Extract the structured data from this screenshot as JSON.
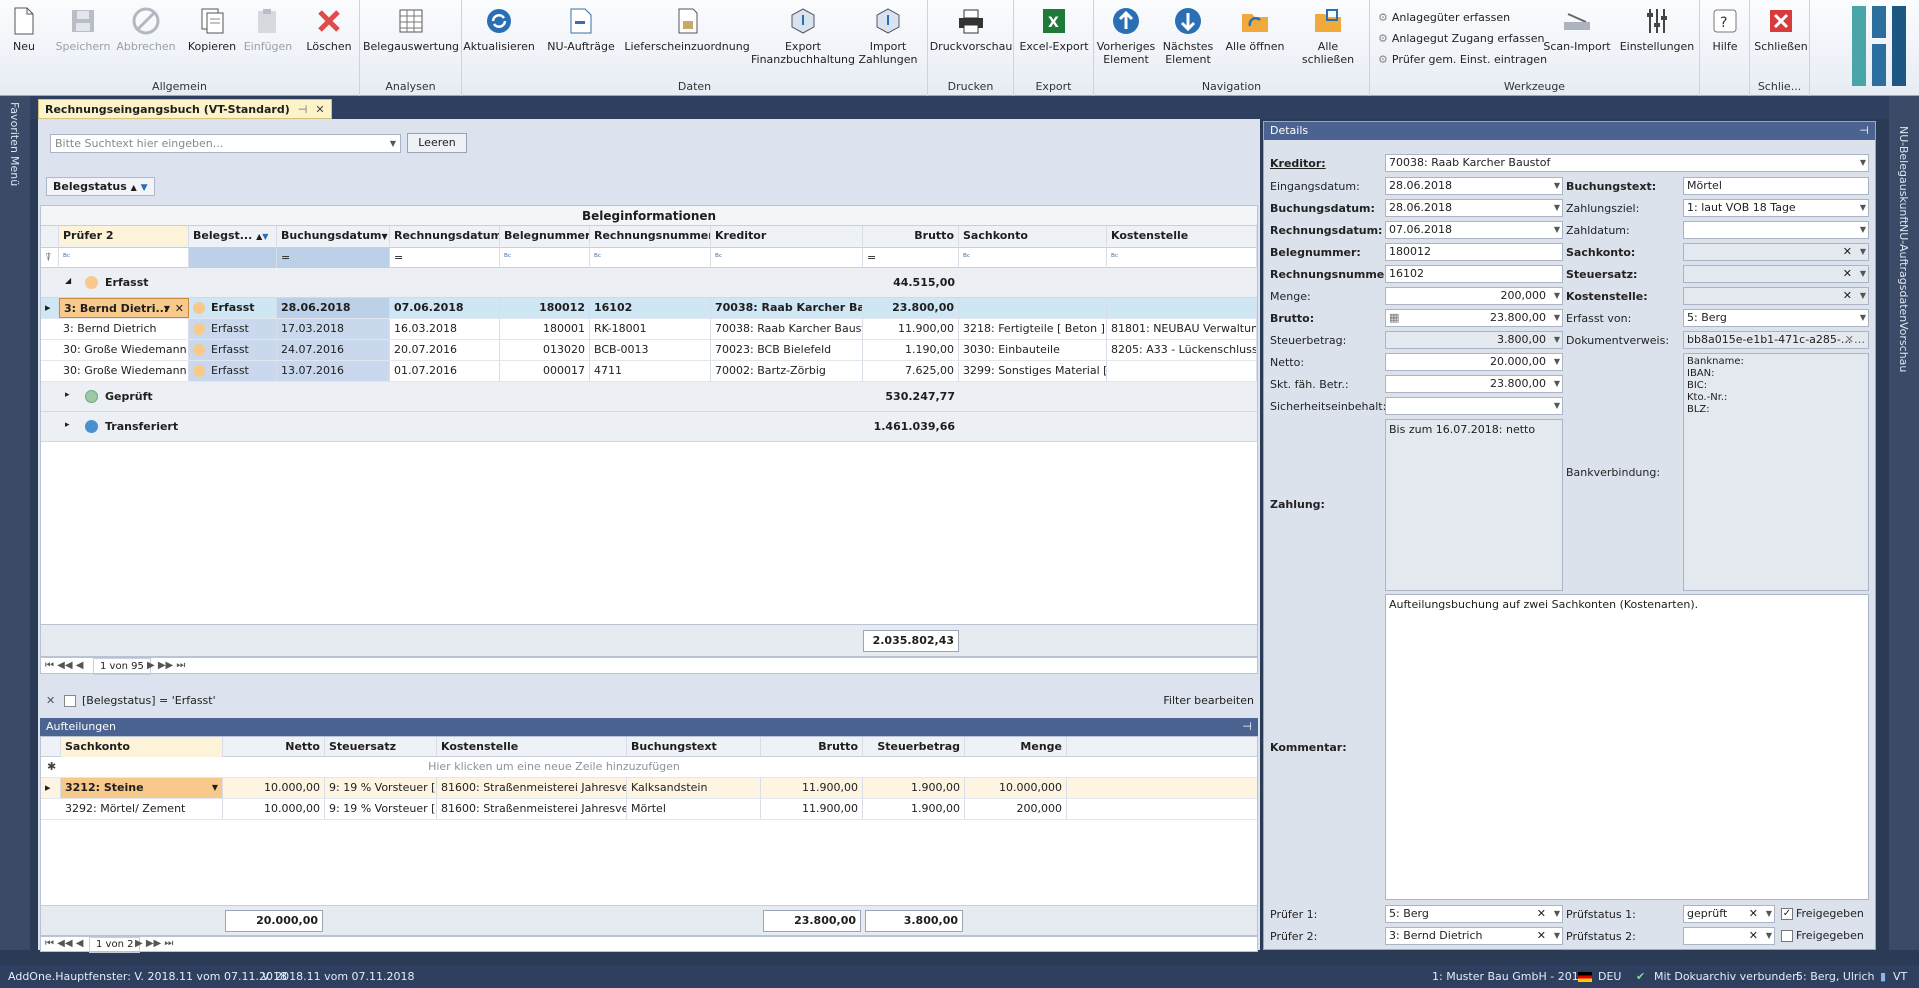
{
  "ribbon": {
    "groups": {
      "allgemein": "Allgemein",
      "analysen": "Analysen",
      "daten": "Daten",
      "drucken": "Drucken",
      "export": "Export",
      "navigation": "Navigation",
      "werkzeuge": "Werkzeuge",
      "schliessen": "Schlie..."
    },
    "buttons": {
      "neu": "Neu",
      "speichern": "Speichern",
      "abbrechen": "Abbrechen",
      "kopieren": "Kopieren",
      "einfuegen": "Einfügen",
      "loeschen": "Löschen",
      "belegauswertung": "Belegauswertung",
      "aktualisieren": "Aktualisieren",
      "nu_auftraege": "NU-Aufträge",
      "lieferschein": "Lieferscheinzuordnung",
      "export_fibu": "Export\nFinanzbuchhaltung",
      "import_zahlungen": "Import\nZahlungen",
      "druckvorschau": "Druckvorschau",
      "excel_export": "Excel-Export",
      "vorheriges": "Vorheriges\nElement",
      "naechstes": "Nächstes\nElement",
      "alle_oeffnen": "Alle öffnen",
      "alle_schliessen": "Alle schließen",
      "scan_import": "Scan-Import",
      "einstellungen": "Einstellungen",
      "hilfe": "Hilfe",
      "schliessen": "Schließen"
    },
    "werkzeuge_small": [
      "Anlagegüter erfassen",
      "Anlagegut Zugang erfassen",
      "Prüfer gem. Einst. eintragen"
    ]
  },
  "sidebar_left": [
    "Favoriten",
    "Menü"
  ],
  "sidebar_right": [
    "NU-Belegauskunft",
    "NU-Auftragsdaten",
    "Vorschau"
  ],
  "doc_tab": "Rechnungseingangsbuch (VT-Standard)",
  "search": {
    "placeholder": "Bitte Suchtext hier eingeben...",
    "clear": "Leeren"
  },
  "group_chip": "Belegstatus",
  "grid": {
    "band": "Beleginformationen",
    "columns": [
      "Prüfer 2",
      "Belegst...",
      "Buchungsdatum",
      "Rechnungsdatum",
      "Belegnummer",
      "Rechnungsnummer",
      "Kreditor",
      "Brutto",
      "Sachkonto",
      "Kostenstelle"
    ],
    "filter_ops": [
      "ᴮᶜ",
      "",
      "=",
      "=",
      "ᴮᶜ",
      "ᴮᶜ",
      "ᴮᶜ",
      "=",
      "ᴮᶜ",
      "ᴮᶜ"
    ],
    "groups": [
      {
        "label": "Erfasst",
        "total": "44.515,00"
      },
      {
        "label": "Geprüft",
        "total": "530.247,77"
      },
      {
        "label": "Transferiert",
        "total": "1.461.039,66"
      }
    ],
    "rows": [
      [
        "3: Bernd Dietri...",
        "Erfasst",
        "28.06.2018",
        "07.06.2018",
        "180012",
        "16102",
        "70038: Raab Karcher Ba...",
        "23.800,00",
        "",
        ""
      ],
      [
        "3: Bernd Dietrich",
        "Erfasst",
        "17.03.2018",
        "16.03.2018",
        "180001",
        "RK-18001",
        "70038: Raab Karcher Baustof",
        "11.900,00",
        "3218: Fertigteile [ Beton ]",
        "81801: NEUBAU Verwaltung Imr"
      ],
      [
        "30: Große Wiedemann",
        "Erfasst",
        "24.07.2016",
        "20.07.2016",
        "013020",
        "BCB-0013",
        "70023: BCB Bielefeld",
        "1.190,00",
        "3030: Einbauteile",
        "8205: A33 - Lückenschluss"
      ],
      [
        "30: Große Wiedemann",
        "Erfasst",
        "13.07.2016",
        "01.07.2016",
        "000017",
        "4711",
        "70002: Bartz-Zörbig",
        "7.625,00",
        "3299: Sonstiges  Material [...",
        ""
      ]
    ],
    "footer_total": "2.035.802,43",
    "pager": "1 von 95"
  },
  "filter_bar": {
    "text": "[Belegstatus] = 'Erfasst'",
    "edit": "Filter bearbeiten"
  },
  "aufteilungen": {
    "title": "Aufteilungen",
    "columns": [
      "Sachkonto",
      "Netto",
      "Steuersatz",
      "Kostenstelle",
      "Buchungstext",
      "Brutto",
      "Steuerbetrag",
      "Menge"
    ],
    "new_row_hint": "Hier klicken um eine neue Zeile hinzuzufügen",
    "rows": [
      [
        "3212: Steine",
        "10.000,00",
        "9: 19 % Vorsteuer [ERG]",
        "81600: Straßenmeisterei Jahresvertrag",
        "Kalksandstein",
        "11.900,00",
        "1.900,00",
        "10.000,000"
      ],
      [
        "3292: Mörtel/ Zement",
        "10.000,00",
        "9: 19 % Vorsteuer [ERG]",
        "81600: Straßenmeisterei Jahresvertrag",
        "Mörtel",
        "11.900,00",
        "1.900,00",
        "200,000"
      ]
    ],
    "totals": {
      "netto": "20.000,00",
      "brutto": "23.800,00",
      "steuer": "3.800,00"
    },
    "pager": "1 von 2"
  },
  "details": {
    "title": "Details",
    "kreditor_label": "Kreditor:",
    "kreditor": "70038: Raab Karcher Baustof",
    "eingangsdatum_label": "Eingangsdatum:",
    "eingangsdatum": "28.06.2018",
    "buchungsdatum_label": "Buchungsdatum:",
    "buchungsdatum": "28.06.2018",
    "rechnungsdatum_label": "Rechnungsdatum:",
    "rechnungsdatum": "07.06.2018",
    "belegnummer_label": "Belegnummer:",
    "belegnummer": "180012",
    "rechnungsnummer_label": "Rechnungsnummer:",
    "rechnungsnummer": "16102",
    "menge_label": "Menge:",
    "menge": "200,000",
    "brutto_label": "Brutto:",
    "brutto": "23.800,00",
    "steuerbetrag_label": "Steuerbetrag:",
    "steuerbetrag": "3.800,00",
    "netto_label": "Netto:",
    "netto": "20.000,00",
    "skonto_label": "Skt. fäh. Betr.:",
    "skonto": "23.800,00",
    "sicherheit_label": "Sicherheitseinbehalt:",
    "sicherheit": "",
    "zahlung_label": "Zahlung:",
    "zahlung": "Bis zum 16.07.2018: netto",
    "buchungstext_label": "Buchungstext:",
    "buchungstext": "Mörtel",
    "zahlungsziel_label": "Zahlungsziel:",
    "zahlungsziel": "1: laut  VOB  18 Tage",
    "zahldatum_label": "Zahldatum:",
    "zahldatum": "",
    "sachkonto_label": "Sachkonto:",
    "steuersatz_label": "Steuersatz:",
    "kostenstelle_label": "Kostenstelle:",
    "erfasst_label": "Erfasst von:",
    "erfasst": "5: Berg",
    "dokument_label": "Dokumentverweis:",
    "dokument": "bb8a015e-e1b1-471c-a285-...",
    "bank_label": "Bankverbindung:",
    "bank_lines": [
      "Bankname:",
      "IBAN:",
      "BIC:",
      "Kto.-Nr.:",
      "BLZ:"
    ],
    "kommentar_label": "Kommentar:",
    "kommentar": "Aufteilungsbuchung auf zwei Sachkonten (Kostenarten).",
    "pruefer1_label": "Prüfer 1:",
    "pruefer1": "5: Berg",
    "pruefer2_label": "Prüfer 2:",
    "pruefer2": "3: Bernd Dietrich",
    "pruefstatus1_label": "Prüfstatus 1:",
    "pruefstatus1": "geprüft",
    "pruefstatus2_label": "Prüfstatus 2:",
    "pruefstatus2": "",
    "freigegeben": "Freigegeben"
  },
  "statusbar": {
    "left1": "AddOne.Hauptfenster: V. 2018.11 vom 07.11.2018",
    "left2": "V. 2018.11 vom 07.11.2018",
    "company": "1: Muster Bau GmbH - 2018",
    "lang": "DEU",
    "archive": "Mit Dokuarchiv verbunden",
    "user": "5: Berg, Ulrich",
    "vt": "VT"
  },
  "colors": {
    "accent": "#2e3f5f",
    "selected_row": "#cfe6f5",
    "orange": "#f7c98b"
  }
}
